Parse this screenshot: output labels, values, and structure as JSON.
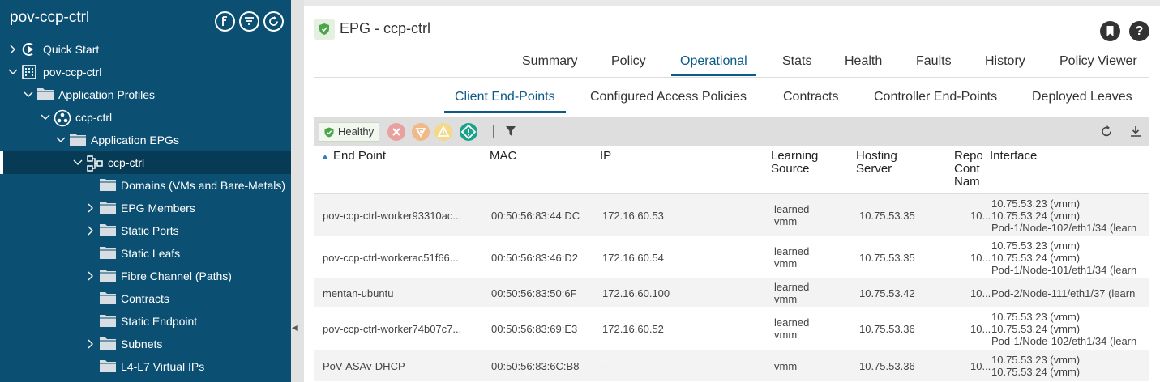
{
  "sidebar": {
    "title": "pov-ccp-ctrl",
    "items": [
      {
        "label": "Quick Start",
        "icon": "quick-start-icon",
        "chevron": "right"
      },
      {
        "label": "pov-ccp-ctrl",
        "icon": "tenant-building-icon",
        "chevron": "down"
      },
      {
        "label": "Application Profiles",
        "icon": "folder-icon",
        "chevron": "down"
      },
      {
        "label": "ccp-ctrl",
        "icon": "application-profile-icon",
        "chevron": "down"
      },
      {
        "label": "Application EPGs",
        "icon": "folder-icon",
        "chevron": "down"
      },
      {
        "label": "ccp-ctrl",
        "icon": "epg-icon",
        "chevron": "down",
        "selected": true
      },
      {
        "label": "Domains (VMs and Bare-Metals)",
        "icon": "folder-icon",
        "chevron": "none"
      },
      {
        "label": "EPG Members",
        "icon": "folder-icon",
        "chevron": "right"
      },
      {
        "label": "Static Ports",
        "icon": "folder-icon",
        "chevron": "right"
      },
      {
        "label": "Static Leafs",
        "icon": "folder-icon",
        "chevron": "none"
      },
      {
        "label": "Fibre Channel (Paths)",
        "icon": "folder-icon",
        "chevron": "right"
      },
      {
        "label": "Contracts",
        "icon": "folder-icon",
        "chevron": "none"
      },
      {
        "label": "Static Endpoint",
        "icon": "folder-icon",
        "chevron": "none"
      },
      {
        "label": "Subnets",
        "icon": "folder-icon",
        "chevron": "right"
      },
      {
        "label": "L4-L7 Virtual IPs",
        "icon": "folder-icon",
        "chevron": "none"
      }
    ]
  },
  "header": {
    "title": "EPG - ccp-ctrl",
    "bookmark_icon": "bookmark-icon",
    "help_label": "?"
  },
  "tabs": {
    "primary": [
      "Summary",
      "Policy",
      "Operational",
      "Stats",
      "Health",
      "Faults",
      "History",
      "Policy Viewer"
    ],
    "primary_active": "Operational",
    "secondary": [
      "Client End-Points",
      "Configured Access Policies",
      "Contracts",
      "Controller End-Points",
      "Deployed Leaves"
    ],
    "secondary_active": "Client End-Points"
  },
  "toolbar": {
    "health_label": "Healthy",
    "fault_colors": {
      "critical": "#e8a19f",
      "major": "#f0b98a",
      "minor": "#f4d98a",
      "warning": "#1aa38a"
    }
  },
  "table": {
    "columns": [
      "End Point",
      "MAC",
      "IP",
      "Learning Source",
      "Hosting Server",
      "Reporting Controller Name",
      "Interface"
    ],
    "column_header_lines": [
      [
        "End Point"
      ],
      [
        "MAC"
      ],
      [
        "IP"
      ],
      [
        "Learning",
        "Source"
      ],
      [
        "Hosting",
        "Server"
      ],
      [
        "Repo",
        "Cont",
        "Nam"
      ],
      [
        "Interface"
      ]
    ],
    "rows": [
      {
        "endpoint": "pov-ccp-ctrl-worker93310ac...",
        "mac": "00:50:56:83:44:DC",
        "ip": "172.16.60.53",
        "learning": [
          "learned",
          "vmm"
        ],
        "server": "10.75.53.35",
        "controller": "10...",
        "interface": [
          "10.75.53.23 (vmm)",
          "10.75.53.24 (vmm)",
          "Pod-1/Node-102/eth1/34 (learn"
        ]
      },
      {
        "endpoint": "pov-ccp-ctrl-workerac51f66...",
        "mac": "00:50:56:83:46:D2",
        "ip": "172.16.60.54",
        "learning": [
          "learned",
          "vmm"
        ],
        "server": "10.75.53.35",
        "controller": "10...",
        "interface": [
          "10.75.53.23 (vmm)",
          "10.75.53.24 (vmm)",
          "Pod-1/Node-101/eth1/34 (learn"
        ]
      },
      {
        "endpoint": "mentan-ubuntu",
        "mac": "00:50:56:83:50:6F",
        "ip": "172.16.60.100",
        "learning": [
          "learned",
          "vmm"
        ],
        "server": "10.75.53.42",
        "controller": "10...",
        "interface": [
          "Pod-2/Node-111/eth1/37 (learn"
        ]
      },
      {
        "endpoint": "pov-ccp-ctrl-worker74b07c7...",
        "mac": "00:50:56:83:69:E3",
        "ip": "172.16.60.52",
        "learning": [
          "learned",
          "vmm"
        ],
        "server": "10.75.53.36",
        "controller": "10...",
        "interface": [
          "10.75.53.23 (vmm)",
          "10.75.53.24 (vmm)",
          "Pod-1/Node-102/eth1/34 (learn"
        ]
      },
      {
        "endpoint": "PoV-ASAv-DHCP",
        "mac": "00:50:56:83:6C:B8",
        "ip": "---",
        "learning": [
          "vmm"
        ],
        "server": "10.75.53.36",
        "controller": "10...",
        "interface": [
          "10.75.53.23 (vmm)",
          "10.75.53.24 (vmm)"
        ]
      }
    ]
  }
}
